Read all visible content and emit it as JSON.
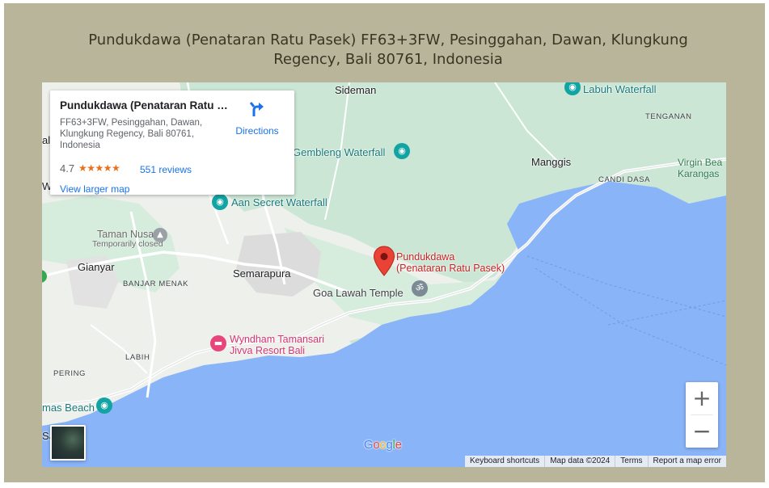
{
  "title": "Pundukdawa (Penataran Ratu Pasek) FF63+3FW, Pesinggahan, Dawan, Klungkung Regency, Bali 80761, Indonesia",
  "map": {
    "labels": {
      "sideman": "Sideman",
      "labuh": "Labuh Waterfall",
      "tenganan": "TENGANAN",
      "gembleng": "Gembleng Waterfall",
      "manggis": "Manggis",
      "virgin_1": "Virgin Bea",
      "virgin_2": "Karangas",
      "candi_dasa": "CANDI DASA",
      "aan": "Aan Secret Waterfall",
      "taman_nusa": "Taman Nusa",
      "temp_closed": "Temporarily closed",
      "gianyar": "Gianyar",
      "banjar_menak": "BANJAR MENAK",
      "semarapura": "Semarapura",
      "pin_1": "Pundukdawa",
      "pin_2": "(Penataran Ratu Pasek)",
      "goa_lawah": "Goa Lawah Temple",
      "wyndham_1": "Wyndham Tamansari",
      "wyndham_2": "Jivva Resort Bali",
      "labih": "LABIH",
      "pering": "PERING",
      "beach": "mas Beach",
      "edge_sa": "Sa",
      "edge_al": "al",
      "edge_w": "W"
    },
    "colors": {
      "water": "#8ab4f8",
      "land": "#eef0ec",
      "forest": "#cbe6d5",
      "urban": "#dcdcdc",
      "pin": "#ea4335",
      "poi_teal": "#12a3a3",
      "hotel_pink": "#e8457b"
    }
  },
  "card": {
    "title": "Pundukdawa (Penataran Ratu Pasek)",
    "address": "FF63+3FW, Pesinggahan, Dawan, Klungkung Regency, Bali 80761, Indonesia",
    "rating": "4.7",
    "stars": "★★★★★",
    "reviews": "551 reviews",
    "larger_map": "View larger map",
    "directions": "Directions"
  },
  "controls": {
    "zoom_in": "+",
    "zoom_out": "−"
  },
  "logo": {
    "letters": [
      "G",
      "o",
      "o",
      "g",
      "l",
      "e"
    ],
    "colors": [
      "#4285f4",
      "#ea4335",
      "#fbbc05",
      "#4285f4",
      "#34a853",
      "#ea4335"
    ]
  },
  "footer": {
    "keyboard": "Keyboard shortcuts",
    "map_data": "Map data ©2024",
    "terms": "Terms",
    "report": "Report a map error"
  }
}
